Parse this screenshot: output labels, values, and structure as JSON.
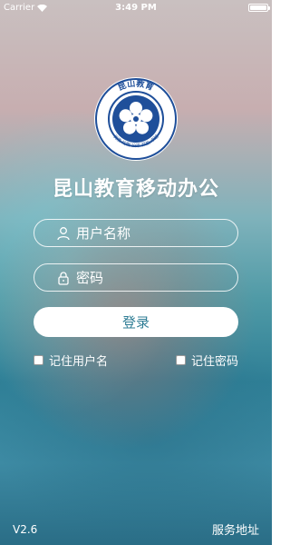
{
  "status_bar": {
    "carrier": "Carrier",
    "time": "3:49 PM"
  },
  "logo": {
    "top_text": "昆山教育",
    "left_text": "KUNSHAN",
    "right_text": "EDUCATION",
    "bottom_text": "优质 均衡 公平 开放 卓越",
    "ring_color": "#1f4f9a"
  },
  "app": {
    "title": "昆山教育移动办公",
    "version": "V2.6"
  },
  "form": {
    "username_placeholder": "用户名称",
    "password_placeholder": "密码",
    "login_label": "登录",
    "remember_username": "记住用户名",
    "remember_password": "记住密码"
  },
  "footer": {
    "service_address": "服务地址"
  },
  "colors": {
    "button_text": "#2f7d95"
  }
}
